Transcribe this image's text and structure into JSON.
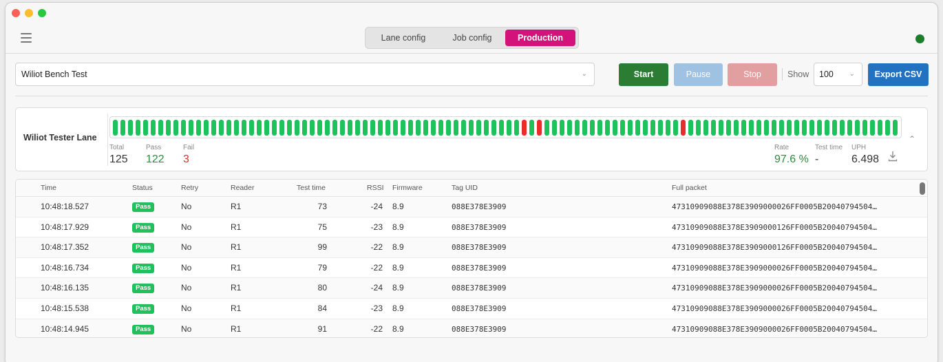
{
  "window": {
    "controls": [
      "close",
      "minimize",
      "zoom"
    ]
  },
  "header": {
    "tabs": [
      {
        "label": "Lane config",
        "active": false
      },
      {
        "label": "Job config",
        "active": false
      },
      {
        "label": "Production",
        "active": true
      }
    ],
    "status_color": "#1e7d2a"
  },
  "toolbar": {
    "job_value": "Wiliot Bench Test",
    "start_label": "Start",
    "pause_label": "Pause",
    "stop_label": "Stop",
    "show_label": "Show",
    "show_value": "100",
    "export_label": "Export CSV"
  },
  "lane": {
    "name": "Wiliot Tester Lane",
    "fail_positions": [
      54,
      56,
      75
    ],
    "total_label": "Total",
    "total_value": "125",
    "pass_label": "Pass",
    "pass_value": "122",
    "fail_label": "Fail",
    "fail_value": "3",
    "rate_label": "Rate",
    "rate_value": "97.6 %",
    "test_time_label": "Test time",
    "test_time_value": "-",
    "uph_label": "UPH",
    "uph_value": "6.498"
  },
  "table": {
    "columns": {
      "time": "Time",
      "status": "Status",
      "retry": "Retry",
      "reader": "Reader",
      "test_time": "Test time",
      "rssi": "RSSI",
      "firmware": "Firmware",
      "tag_uid": "Tag UID",
      "full_packet": "Full packet"
    },
    "rows": [
      {
        "time": "10:48:18.527",
        "status": "Pass",
        "retry": "No",
        "reader": "R1",
        "test_time": "73",
        "rssi": "-24",
        "firmware": "8.9",
        "tag_uid": "088E378E3909",
        "full_packet": "47310909088E378E3909000026FF0005B20040794504…"
      },
      {
        "time": "10:48:17.929",
        "status": "Pass",
        "retry": "No",
        "reader": "R1",
        "test_time": "75",
        "rssi": "-23",
        "firmware": "8.9",
        "tag_uid": "088E378E3909",
        "full_packet": "47310909088E378E3909000126FF0005B20040794504…"
      },
      {
        "time": "10:48:17.352",
        "status": "Pass",
        "retry": "No",
        "reader": "R1",
        "test_time": "99",
        "rssi": "-22",
        "firmware": "8.9",
        "tag_uid": "088E378E3909",
        "full_packet": "47310909088E378E3909000126FF0005B20040794504…"
      },
      {
        "time": "10:48:16.734",
        "status": "Pass",
        "retry": "No",
        "reader": "R1",
        "test_time": "79",
        "rssi": "-22",
        "firmware": "8.9",
        "tag_uid": "088E378E3909",
        "full_packet": "47310909088E378E3909000026FF0005B20040794504…"
      },
      {
        "time": "10:48:16.135",
        "status": "Pass",
        "retry": "No",
        "reader": "R1",
        "test_time": "80",
        "rssi": "-24",
        "firmware": "8.9",
        "tag_uid": "088E378E3909",
        "full_packet": "47310909088E378E3909000026FF0005B20040794504…"
      },
      {
        "time": "10:48:15.538",
        "status": "Pass",
        "retry": "No",
        "reader": "R1",
        "test_time": "84",
        "rssi": "-23",
        "firmware": "8.9",
        "tag_uid": "088E378E3909",
        "full_packet": "47310909088E378E3909000026FF0005B20040794504…"
      },
      {
        "time": "10:48:14.945",
        "status": "Pass",
        "retry": "No",
        "reader": "R1",
        "test_time": "91",
        "rssi": "-22",
        "firmware": "8.9",
        "tag_uid": "088E378E3909",
        "full_packet": "47310909088E378E3909000026FF0005B20040794504…"
      }
    ]
  },
  "colors": {
    "accent": "#d4127b",
    "pass": "#1ec25a",
    "fail": "#e92c2c",
    "start": "#2a7d33",
    "export": "#2371c1"
  }
}
